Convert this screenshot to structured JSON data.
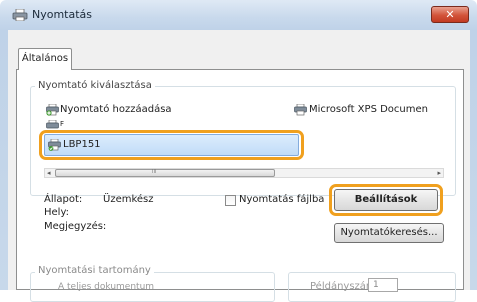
{
  "window": {
    "title": "Nyomtatás",
    "close_glyph": "✕"
  },
  "tabs": [
    {
      "label": "Általános"
    }
  ],
  "printer_selection": {
    "group_label": "Nyomtató kiválasztása",
    "items": [
      {
        "label": "Nyomtató hozzáadása",
        "icon": "add-printer-icon"
      },
      {
        "label": "Microsoft XPS Documen",
        "icon": "printer-icon"
      },
      {
        "label": "F",
        "icon": "fax-icon"
      }
    ],
    "selected": {
      "label": "LBP151",
      "icon": "printer-icon"
    },
    "scrollbar": {
      "left_arrow": "◂",
      "right_arrow": "▸",
      "grip": "III"
    }
  },
  "status": {
    "status_label": "Állapot:",
    "status_value": "Üzemkész",
    "location_label": "Hely:",
    "comment_label": "Megjegyzés:",
    "print_to_file_label": "Nyomtatás fájlba",
    "preferences_button": "Beállítások",
    "find_printer_button": "Nyomtatókeresés..."
  },
  "page_range": {
    "group_label": "Nyomtatási tartomány",
    "all_pages_label": "A teljes dokumentum",
    "copies_label": "Példányszám:",
    "copies_value": "1"
  },
  "colors": {
    "callout": "#f0a01e",
    "selection": "#c1dcf8",
    "close": "#d2543a"
  }
}
